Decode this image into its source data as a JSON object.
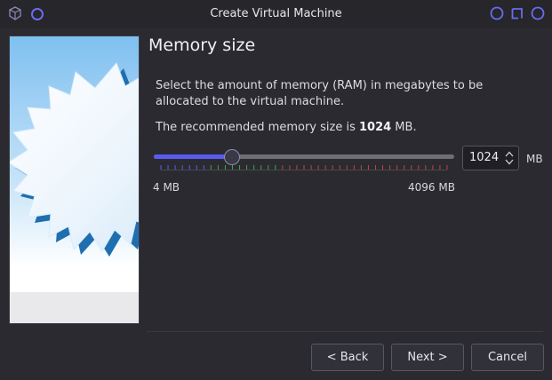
{
  "window": {
    "title": "Create Virtual Machine"
  },
  "page": {
    "title": "Memory size",
    "description": "Select the amount of memory (RAM) in megabytes to be allocated to the virtual machine.",
    "recommended_prefix": "The recommended memory size is ",
    "recommended_value": "1024",
    "recommended_suffix": " MB."
  },
  "memory": {
    "slider_min": 4,
    "slider_max": 4096,
    "slider_value": 1024,
    "min_label": "4 MB",
    "max_label": "4096 MB",
    "spin_value": "1024",
    "unit": "MB"
  },
  "buttons": {
    "back": "< Back",
    "next": "Next >",
    "cancel": "Cancel"
  },
  "colors": {
    "accent": "#5a5cf0",
    "tick_safe": "#3fa84a",
    "tick_warn": "#c44343",
    "tick_neutral": "#5a5cf0"
  },
  "icons": {
    "app": "virtualbox-cube-icon",
    "title_circle": "circle-icon",
    "minimize": "minimize-icon",
    "maximize": "maximize-icon",
    "close": "close-icon",
    "spin_up": "chevron-up-icon",
    "spin_down": "chevron-down-icon"
  }
}
